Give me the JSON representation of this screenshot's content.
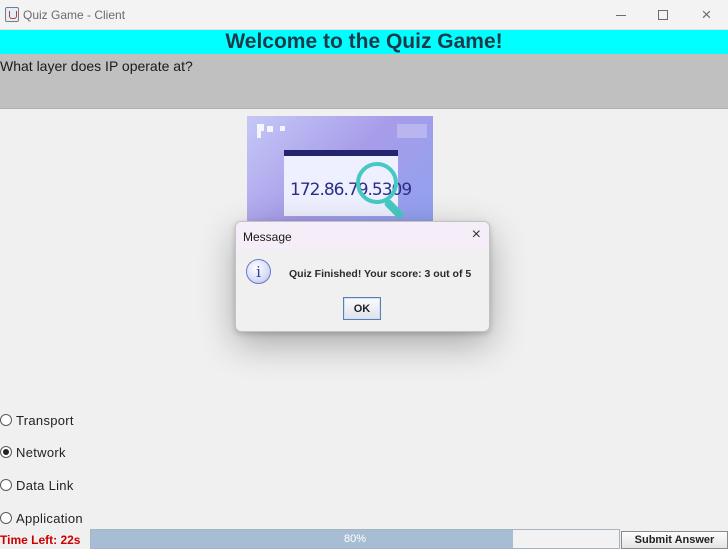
{
  "window": {
    "title": "Quiz Game - Client",
    "controls": {
      "minimize": "minimize",
      "maximize": "maximize",
      "close": "×"
    }
  },
  "header": {
    "title": "Welcome to the Quiz Game!"
  },
  "question": {
    "text": "What layer does IP operate at?",
    "image_text": "172.86.79.5309"
  },
  "options": [
    {
      "label": "Transport",
      "selected": false
    },
    {
      "label": "Network",
      "selected": true
    },
    {
      "label": "Data Link",
      "selected": false
    },
    {
      "label": "Application",
      "selected": false
    }
  ],
  "footer": {
    "time_left": "Time Left: 22s",
    "progress": {
      "value": 0.8,
      "label": "80%"
    },
    "submit_label": "Submit Answer"
  },
  "dialog": {
    "title": "Message",
    "close": "×",
    "message": "Quiz Finished! Your score: 3 out of 5",
    "ok_label": "OK",
    "icon": "information-icon"
  },
  "colors": {
    "header_bg": "#00ffff",
    "question_bg": "#c0c0c0",
    "time_left": "#cc0000",
    "progress_fill": "#a7bdd4"
  }
}
